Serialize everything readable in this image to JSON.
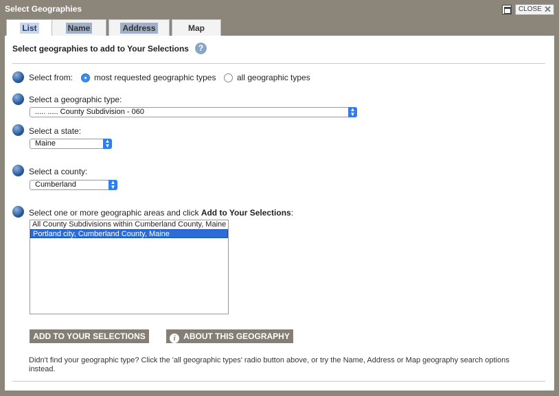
{
  "window": {
    "title": "Select Geographies",
    "close_label": "CLOSE"
  },
  "tabs": [
    "List",
    "Name",
    "Address",
    "Map"
  ],
  "heading": "Select geographies to add to Your Selections",
  "help_icon": "?",
  "step1": {
    "label": "Select from:",
    "options": [
      "most requested geographic types",
      "all geographic types"
    ],
    "selected": "most requested geographic types"
  },
  "step2": {
    "label": "Select a geographic type:",
    "value": "..... ..... County Subdivision - 060"
  },
  "step3": {
    "label": "Select a state:",
    "value": "Maine"
  },
  "step4": {
    "label": "Select a county:",
    "value": "Cumberland"
  },
  "step5": {
    "label_prefix": "Select one or more geographic areas and click ",
    "label_bold": "Add to Your Selections",
    "label_suffix": ":"
  },
  "areas": [
    {
      "text": "All County Subdivisions within Cumberland County, Maine",
      "selected": false
    },
    {
      "text": "Portland city, Cumberland County, Maine",
      "selected": true
    }
  ],
  "buttons": {
    "add": "ADD TO YOUR SELECTIONS",
    "about": "ABOUT THIS GEOGRAPHY"
  },
  "footer_note": "Didn't find your geographic type? Click the 'all geographic types' radio button above, or try the Name, Address or Map geography search options instead.",
  "colors": {
    "frame": "#8c857a",
    "accent": "#2b6cd6",
    "button": "#857e74"
  }
}
